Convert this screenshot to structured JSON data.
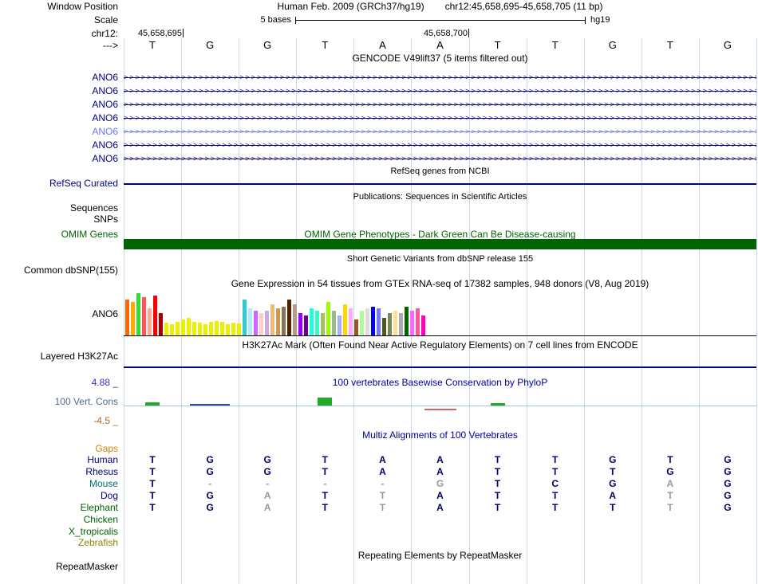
{
  "header": {
    "assembly_title": "Human Feb. 2009 (GRCh37/hg19)",
    "position_title": "chr12:45,658,695-45,658,705 (11 bp)",
    "window_position_label": "Window Position",
    "scale_label": "Scale",
    "scale_text": "5 bases",
    "assembly_short": "hg19",
    "chrom_label": "chr12:",
    "strand_arrow": "--->",
    "coord_left": "45,658,695",
    "coord_right": "45,658,700"
  },
  "tracks": {
    "gencode": {
      "title": "GENCODE V49lift37 (5 items filtered out)",
      "gene_label": "ANO6",
      "transcript_count": 7,
      "light_row_index": 4,
      "color": "#000080",
      "light_color": "#6677EE"
    },
    "refseq": {
      "title": "RefSeq genes from NCBI",
      "label": "RefSeq Curated",
      "color": "#000080"
    },
    "publications": {
      "title": "Publications: Sequences in Scientific Articles",
      "row_labels": [
        "Sequences",
        "SNPs"
      ]
    },
    "omim": {
      "title": "OMIM Gene Phenotypes - Dark Green Can Be Disease-causing",
      "label": "OMIM Genes",
      "color": "#006400"
    },
    "dbsnp": {
      "title": "Short Genetic Variants from dbSNP release 155",
      "label": "Common dbSNP(155)"
    },
    "gtex": {
      "title": "Gene Expression in 54 tissues from GTEx RNA-seq of 17382 samples, 948 donors (V8, Aug 2019)",
      "label": "ANO6"
    },
    "h3k27ac": {
      "title": "H3K27Ac Mark (Often Found Near Active Regulatory Elements) on 7 cell lines from ENCODE",
      "label": "Layered H3K27Ac",
      "color": "#000080"
    },
    "conservation": {
      "title": "100 vertebrates Basewise Conservation by PhyloP",
      "label": "100 Vert. Cons",
      "max_label": "4.88 _",
      "min_label": "-4.5 _",
      "title_color": "#000099",
      "max_color": "#3333BB",
      "min_color": "#BB6622",
      "label_color": "#556688"
    },
    "multiz": {
      "title": "Multiz Alignments of 100 Vertebrates",
      "title_color": "#000099"
    },
    "repeatmasker": {
      "title": "Repeating Elements by RepeatMasker",
      "label": "RepeatMasker"
    }
  },
  "chart_data": {
    "type": "genome-browser-tracks",
    "coordinates": {
      "chrom": "chr12",
      "start": 45658695,
      "end": 45658705,
      "span_bp": 11,
      "labeled_ticks": [
        45658695,
        45658700
      ]
    },
    "sequence": [
      "T",
      "G",
      "G",
      "T",
      "A",
      "A",
      "T",
      "T",
      "G",
      "T",
      "G"
    ],
    "alignment": {
      "note": "lowercase = gray/low-quality letter, '-' = gap, '' = no alignment shown",
      "species": [
        {
          "name": "Gaps",
          "label_color": "#CC8800",
          "cells": [
            "",
            "",
            "",
            "",
            "",
            "",
            "",
            "",
            "",
            "",
            ""
          ]
        },
        {
          "name": "Human",
          "label_color": "#000080",
          "cells": [
            "T",
            "G",
            "G",
            "T",
            "A",
            "A",
            "T",
            "T",
            "G",
            "T",
            "G"
          ]
        },
        {
          "name": "Rhesus",
          "label_color": "#000080",
          "cells": [
            "T",
            "G",
            "G",
            "T",
            "A",
            "A",
            "T",
            "T",
            "T",
            "G",
            "G"
          ]
        },
        {
          "name": "Mouse",
          "label_color": "#007070",
          "cells": [
            "T",
            "-",
            "-",
            "-",
            "-",
            "g",
            "T",
            "C",
            "G",
            "a",
            "G"
          ]
        },
        {
          "name": "Dog",
          "label_color": "#000080",
          "cells": [
            "T",
            "G",
            "a",
            "T",
            "t",
            "A",
            "T",
            "T",
            "A",
            "t",
            "G"
          ]
        },
        {
          "name": "Elephant",
          "label_color": "#006400",
          "cells": [
            "T",
            "G",
            "a",
            "T",
            "t",
            "A",
            "T",
            "T",
            "T",
            "t",
            "G"
          ]
        },
        {
          "name": "Chicken",
          "label_color": "#006400",
          "cells": [
            "",
            "",
            "",
            "",
            "",
            "",
            "",
            "",
            "",
            "",
            ""
          ]
        },
        {
          "name": "X_tropicalis",
          "label_color": "#006400",
          "cells": [
            "",
            "",
            "",
            "",
            "",
            "",
            "",
            "",
            "",
            "",
            ""
          ]
        },
        {
          "name": "Zebrafish",
          "label_color": "#888800",
          "cells": [
            "",
            "",
            "",
            "",
            "",
            "",
            "",
            "",
            "",
            "",
            ""
          ]
        }
      ]
    },
    "gtex": {
      "tissue_count": 54,
      "bar_colors": [
        "#FF6600",
        "#FFAA00",
        "#33DD33",
        "#FF5555",
        "#FFAA99",
        "#FF0000",
        "#AA0000",
        "#EEEE00",
        "#EEEE00",
        "#EEEE00",
        "#EEEE00",
        "#EEEE00",
        "#EEEE00",
        "#EEEE00",
        "#EEEE00",
        "#EEEE00",
        "#EEEE00",
        "#EEEE00",
        "#EEEE00",
        "#EEEE00",
        "#EEEE00",
        "#33CCCC",
        "#AAEEFF",
        "#CC66FF",
        "#FFCCCC",
        "#CCAADD",
        "#EEBB77",
        "#CC9955",
        "#8B7355",
        "#552200",
        "#BB9988",
        "#9900FF",
        "#660099",
        "#22FFDD",
        "#33FFC2",
        "#AABB66",
        "#99FF00",
        "#99BB88",
        "#AAAAFF",
        "#FFD700",
        "#FFAAFF",
        "#995522",
        "#AAFF99",
        "#DDDDDD",
        "#0000FF",
        "#7777FF",
        "#555522",
        "#778855",
        "#FFDD99",
        "#AAAAAA",
        "#006600",
        "#FF66FF",
        "#FF5599",
        "#FF00BB"
      ],
      "bar_heights": [
        0.8,
        0.75,
        0.95,
        0.85,
        0.6,
        0.9,
        0.5,
        0.28,
        0.25,
        0.3,
        0.35,
        0.4,
        0.3,
        0.28,
        0.25,
        0.3,
        0.33,
        0.3,
        0.25,
        0.28,
        0.26,
        0.8,
        0.6,
        0.55,
        0.5,
        0.55,
        0.7,
        0.6,
        0.65,
        0.8,
        0.7,
        0.5,
        0.45,
        0.6,
        0.55,
        0.5,
        0.75,
        0.55,
        0.45,
        0.7,
        0.6,
        0.35,
        0.55,
        0.6,
        0.65,
        0.6,
        0.4,
        0.5,
        0.55,
        0.5,
        0.65,
        0.55,
        0.6,
        0.45
      ]
    },
    "phylop": {
      "range_max": 4.88,
      "range_min": -4.5,
      "values": [
        0.4,
        0,
        null,
        1.0,
        null,
        -0.35,
        0.3,
        null,
        null,
        null,
        null
      ],
      "pos_color": "#22AA22",
      "neg_color": "#CC6666",
      "zero_color": "#3344AA"
    }
  }
}
